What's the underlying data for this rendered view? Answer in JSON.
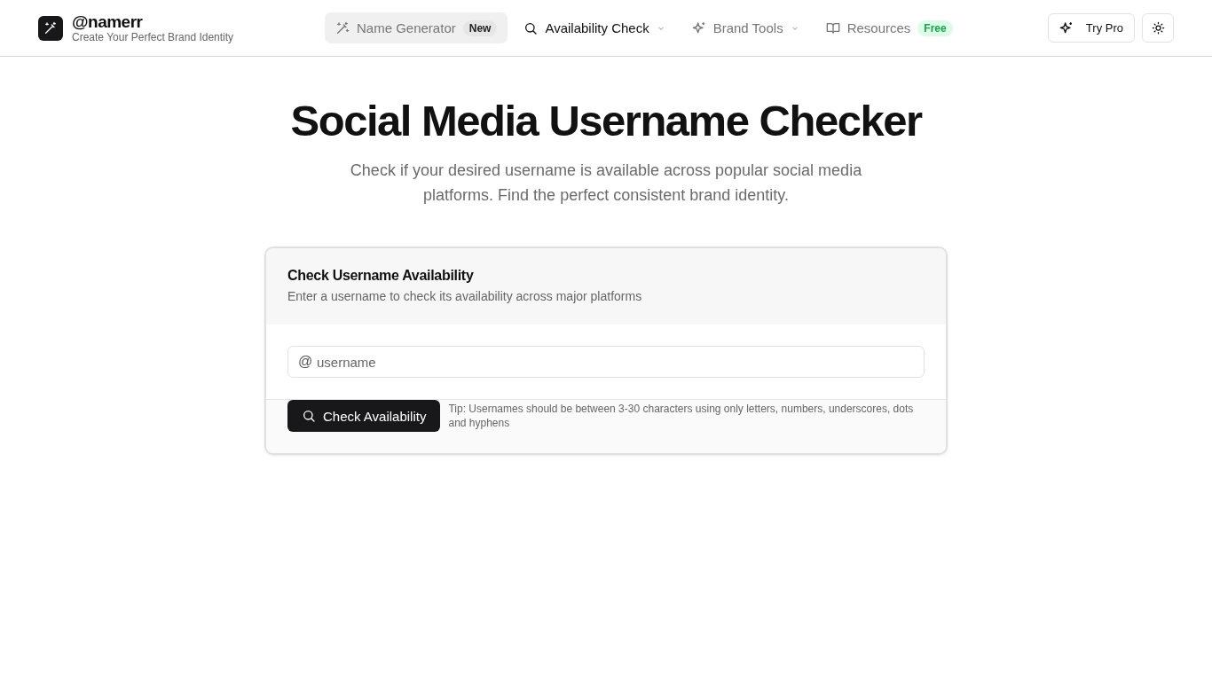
{
  "brand": {
    "name": "@namerr",
    "tagline": "Create Your Perfect Brand Identity"
  },
  "nav": [
    {
      "label": "Name Generator",
      "selected": true,
      "current": false,
      "dropdown": false,
      "badge": {
        "text": "New",
        "kind": "neutral"
      }
    },
    {
      "label": "Availability Check",
      "selected": false,
      "current": true,
      "dropdown": true
    },
    {
      "label": "Brand Tools",
      "selected": false,
      "current": false,
      "dropdown": true
    },
    {
      "label": "Resources",
      "selected": false,
      "current": false,
      "dropdown": false,
      "badge": {
        "text": "Free",
        "kind": "success"
      }
    }
  ],
  "try_pro": "Try Pro",
  "hero": {
    "title": "Social Media Username Checker",
    "subtitle": "Check if your desired username is available across popular social media platforms. Find the perfect consistent brand identity."
  },
  "card": {
    "title": "Check Username Availability",
    "description": "Enter a username to check its availability across major platforms",
    "prefix": "@",
    "placeholder": "username",
    "button": "Check Availability",
    "tip": "Tip: Usernames should be between 3-30 characters using only letters, numbers, underscores, dots and hyphens"
  }
}
